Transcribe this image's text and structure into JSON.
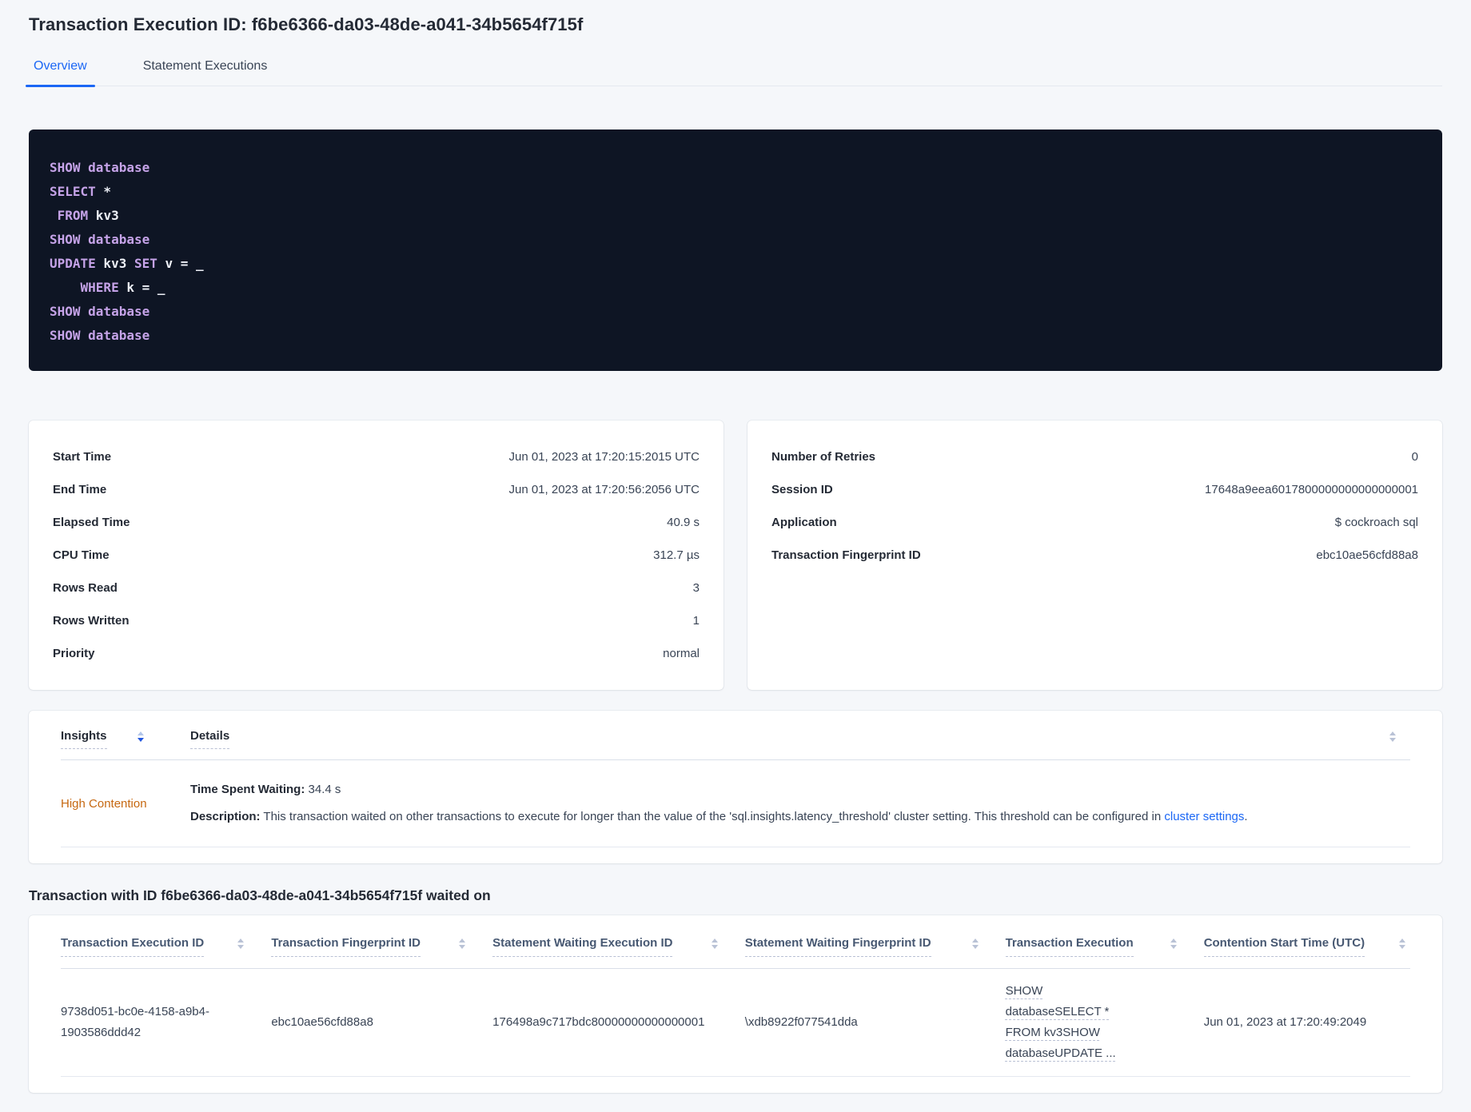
{
  "header": {
    "title": "Transaction Execution ID: f6be6366-da03-48de-a041-34b5654f715f"
  },
  "tabs": {
    "overview": "Overview",
    "statement_executions": "Statement Executions"
  },
  "sql": {
    "lines": [
      [
        {
          "k": "kw",
          "t": "SHOW database"
        }
      ],
      [
        {
          "k": "kw",
          "t": "SELECT"
        },
        {
          "k": "pl",
          "t": " *"
        }
      ],
      [
        {
          "k": "kw",
          "t": " FROM"
        },
        {
          "k": "pl",
          "t": " kv3"
        }
      ],
      [
        {
          "k": "kw",
          "t": "SHOW database"
        }
      ],
      [
        {
          "k": "kw",
          "t": "UPDATE"
        },
        {
          "k": "pl",
          "t": " kv3 "
        },
        {
          "k": "kw",
          "t": "SET"
        },
        {
          "k": "pl",
          "t": " v = _"
        }
      ],
      [
        {
          "k": "kw",
          "t": "    WHERE"
        },
        {
          "k": "pl",
          "t": " k = _"
        }
      ],
      [
        {
          "k": "kw",
          "t": "SHOW database"
        }
      ],
      [
        {
          "k": "kw",
          "t": "SHOW database"
        }
      ]
    ]
  },
  "stats_left": {
    "rows": [
      {
        "label": "Start Time",
        "value": "Jun 01, 2023 at 17:20:15:2015 UTC"
      },
      {
        "label": "End Time",
        "value": "Jun 01, 2023 at 17:20:56:2056 UTC"
      },
      {
        "label": "Elapsed Time",
        "value": "40.9 s"
      },
      {
        "label": "CPU Time",
        "value": "312.7 µs"
      },
      {
        "label": "Rows Read",
        "value": "3"
      },
      {
        "label": "Rows Written",
        "value": "1"
      },
      {
        "label": "Priority",
        "value": "normal"
      }
    ]
  },
  "stats_right": {
    "rows": [
      {
        "label": "Number of Retries",
        "value": "0"
      },
      {
        "label": "Session ID",
        "value": "17648a9eea6017800000000000000001"
      },
      {
        "label": "Application",
        "value": "$ cockroach sql"
      },
      {
        "label": "Transaction Fingerprint ID",
        "value": "ebc10ae56cfd88a8"
      }
    ]
  },
  "insights_table": {
    "col_insights": "Insights",
    "col_details": "Details",
    "row": {
      "insight": "High Contention",
      "time_spent_waiting_label": "Time Spent Waiting:",
      "time_spent_waiting_value": " 34.4 s",
      "description_label": "Description:",
      "description_text": " This transaction waited on other transactions to execute for longer than the value of the 'sql.insights.latency_threshold' cluster setting. This threshold can be configured in ",
      "description_link": "cluster settings",
      "description_end": "."
    }
  },
  "waited_section": {
    "heading": "Transaction with ID f6be6366-da03-48de-a041-34b5654f715f waited on",
    "columns": [
      "Transaction Execution ID",
      "Transaction Fingerprint ID",
      "Statement Waiting Execution ID",
      "Statement Waiting Fingerprint ID",
      "Transaction Execution",
      "Contention Start Time (UTC)"
    ],
    "row": {
      "transaction_execution_id": "9738d051-bc0e-4158-a9b4-1903586ddd42",
      "transaction_fingerprint_id": "ebc10ae56cfd88a8",
      "statement_waiting_execution_id": "176498a9c717bdc80000000000000001",
      "statement_waiting_fingerprint_id": "\\xdb8922f077541dda",
      "transaction_execution": "SHOW databaseSELECT * FROM kv3SHOW databaseUPDATE ...",
      "contention_start_time": "Jun 01, 2023 at 17:20:49:2049"
    }
  }
}
